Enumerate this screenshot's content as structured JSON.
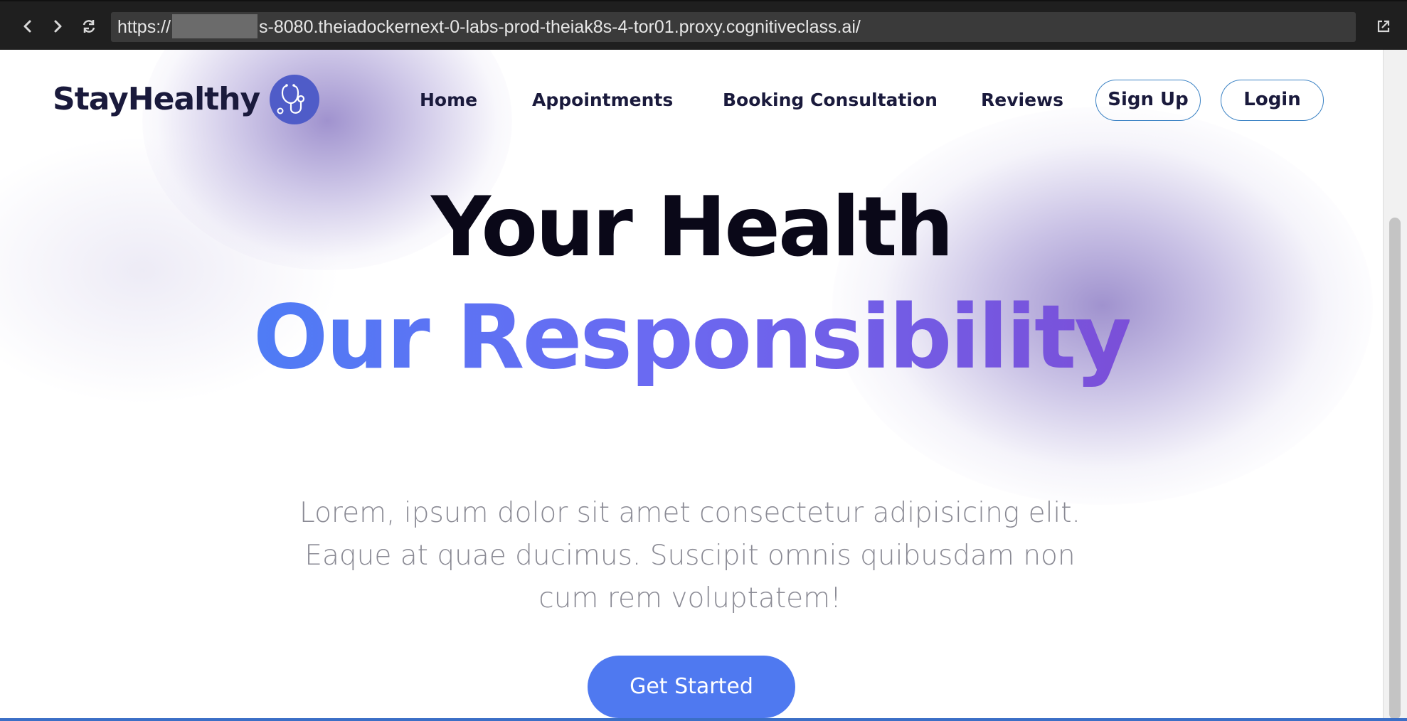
{
  "browser": {
    "url_prefix": "https://",
    "url_suffix": "s-8080.theiadockernext-0-labs-prod-theiak8s-4-tor01.proxy.cognitiveclass.ai/",
    "back_icon": "chevron-left-icon",
    "forward_icon": "chevron-right-icon",
    "reload_icon": "reload-icon",
    "external_icon": "open-external-icon"
  },
  "brand": {
    "name": "StayHealthy",
    "logo_icon": "stethoscope-icon",
    "logo_color": "#4f5cc8"
  },
  "nav": {
    "items": [
      "Home",
      "Appointments",
      "Booking Consultation",
      "Reviews"
    ],
    "signup": "Sign Up",
    "login": "Login"
  },
  "hero": {
    "line1": "Your Health",
    "line2": "Our Responsibility",
    "description": "Lorem, ipsum dolor sit amet consectetur adipisicing elit. Eaque at quae ducimus. Suscipit omnis quibusdam non cum rem voluptatem!",
    "cta": "Get Started"
  },
  "colors": {
    "accent": "#4f79f0",
    "gradient_start": "#4f7cf5",
    "gradient_end": "#7b4fd8",
    "text_dark": "#1a1a3c"
  }
}
